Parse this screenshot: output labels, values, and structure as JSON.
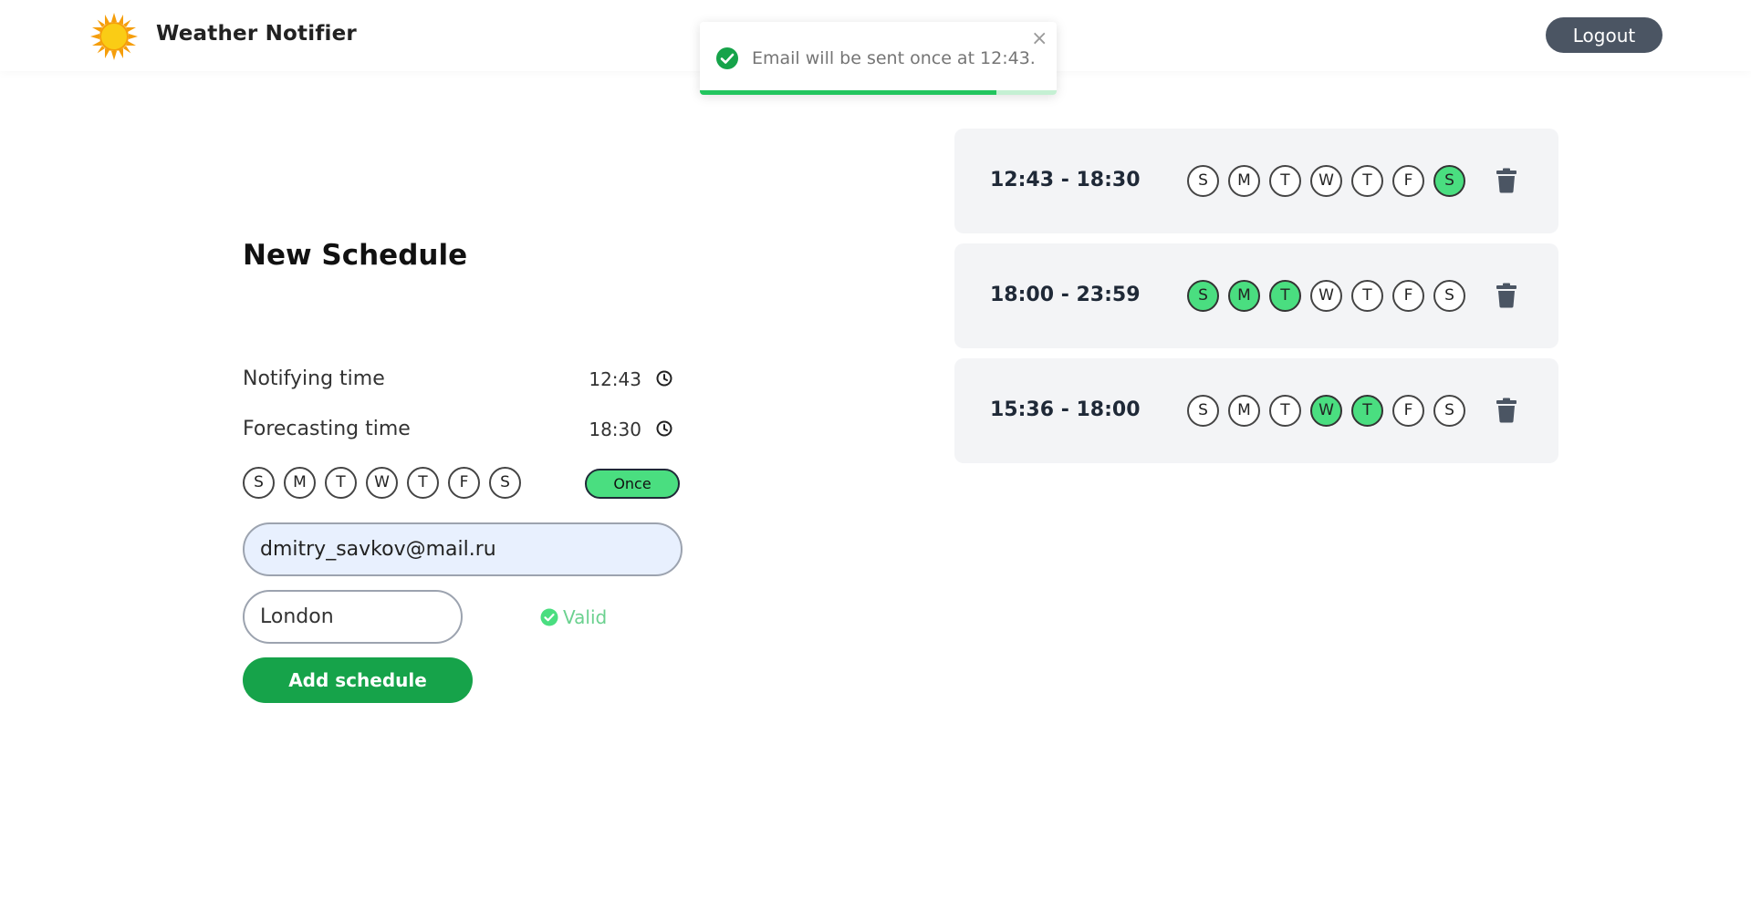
{
  "header": {
    "logo_icon": "sun-icon",
    "app_title": "Weather Notifier",
    "logout_label": "Logout"
  },
  "toast": {
    "icon": "check-circle-icon",
    "message": "Email will be sent once at 12:43.",
    "close_glyph": "×",
    "progress": 0.83
  },
  "form": {
    "title": "New Schedule",
    "notifying_label": "Notifying time",
    "notifying_value": "12:43",
    "forecasting_label": "Forecasting time",
    "forecasting_value": "18:30",
    "days": [
      {
        "letter": "S",
        "active": false
      },
      {
        "letter": "M",
        "active": false
      },
      {
        "letter": "T",
        "active": false
      },
      {
        "letter": "W",
        "active": false
      },
      {
        "letter": "T",
        "active": false
      },
      {
        "letter": "F",
        "active": false
      },
      {
        "letter": "S",
        "active": false
      }
    ],
    "once_label": "Once",
    "email_value": "dmitry_savkov@mail.ru",
    "city_value": "London",
    "valid_label": "Valid",
    "add_label": "Add schedule"
  },
  "schedules": [
    {
      "time": "12:43 - 18:30",
      "days": [
        {
          "letter": "S",
          "active": false
        },
        {
          "letter": "M",
          "active": false
        },
        {
          "letter": "T",
          "active": false
        },
        {
          "letter": "W",
          "active": false
        },
        {
          "letter": "T",
          "active": false
        },
        {
          "letter": "F",
          "active": false
        },
        {
          "letter": "S",
          "active": true
        }
      ]
    },
    {
      "time": "18:00 - 23:59",
      "days": [
        {
          "letter": "S",
          "active": true
        },
        {
          "letter": "M",
          "active": true
        },
        {
          "letter": "T",
          "active": true
        },
        {
          "letter": "W",
          "active": false
        },
        {
          "letter": "T",
          "active": false
        },
        {
          "letter": "F",
          "active": false
        },
        {
          "letter": "S",
          "active": false
        }
      ]
    },
    {
      "time": "15:36 - 18:00",
      "days": [
        {
          "letter": "S",
          "active": false
        },
        {
          "letter": "M",
          "active": false
        },
        {
          "letter": "T",
          "active": false
        },
        {
          "letter": "W",
          "active": true
        },
        {
          "letter": "T",
          "active": true
        },
        {
          "letter": "F",
          "active": false
        },
        {
          "letter": "S",
          "active": false
        }
      ]
    }
  ],
  "colors": {
    "active_day": "#4ade80",
    "primary_button": "#16a34a",
    "logout_button": "#4b5563",
    "valid_text": "#6bd18f",
    "card_background": "#f3f4f6"
  }
}
